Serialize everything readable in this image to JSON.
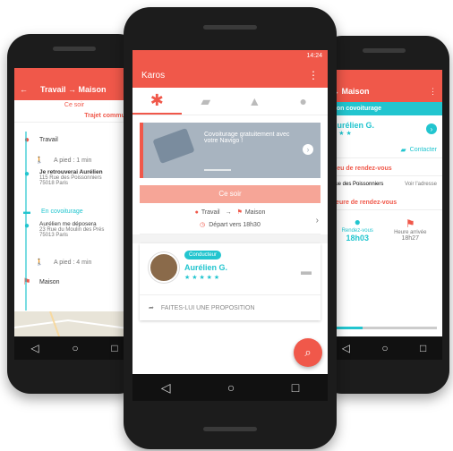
{
  "colors": {
    "accent": "#f0584a",
    "teal": "#22c5cf",
    "dark": "#1c1c1c"
  },
  "center": {
    "status_time": "14:24",
    "app_title": "Karos",
    "menu_icon": "more-vert-icon",
    "tabs": [
      {
        "icon": "karos-logo-icon"
      },
      {
        "icon": "chat-icon"
      },
      {
        "icon": "road-icon"
      },
      {
        "icon": "profile-icon"
      }
    ],
    "promo": {
      "text": "Covoiturage gratuitement avec votre Navigo !"
    },
    "time_banner": "Ce soir",
    "route": {
      "from": "Travail",
      "to": "Maison",
      "departure": "Départ vers 18h30"
    },
    "driver": {
      "badge": "Conducteur",
      "name": "Aurélien G.",
      "stars": "★ ★ ★ ★ ★"
    },
    "proposal": "FAITES-LUI UNE PROPOSITION"
  },
  "left": {
    "title": "Travail → Maison",
    "subtitle": "Ce soir",
    "section": "Trajet commun",
    "steps": [
      {
        "label": "Travail",
        "detail": ""
      },
      {
        "label": "",
        "detail": "A pied : 1 min"
      },
      {
        "label": "Je retrouverai Aurélien",
        "detail": "115 Rue des Poissonniers 75018 Paris"
      },
      {
        "label": "",
        "detail": "En covoiturage"
      },
      {
        "label": "Aurélien me déposera",
        "detail": "23 Rue du Moulin des Prés 75013 Paris"
      },
      {
        "label": "",
        "detail": "A pied : 4 min"
      },
      {
        "label": "Maison",
        "detail": ""
      }
    ]
  },
  "right": {
    "title": "→ Maison",
    "section1": "Mon covoiturage",
    "driver_name": "Aurélien G.",
    "stars": "★ ★ ★",
    "contact": "Contacter",
    "section2": "Lieu de rendez-vous",
    "place": "Rue des Poissonniers",
    "place_link": "Voir l'adresse",
    "section3": "Heure de rendez-vous",
    "meet_label": "Rendez-vous",
    "meet_time": "18h03",
    "arrival_label": "Heure arrivée",
    "arrival_time": "18h27"
  }
}
